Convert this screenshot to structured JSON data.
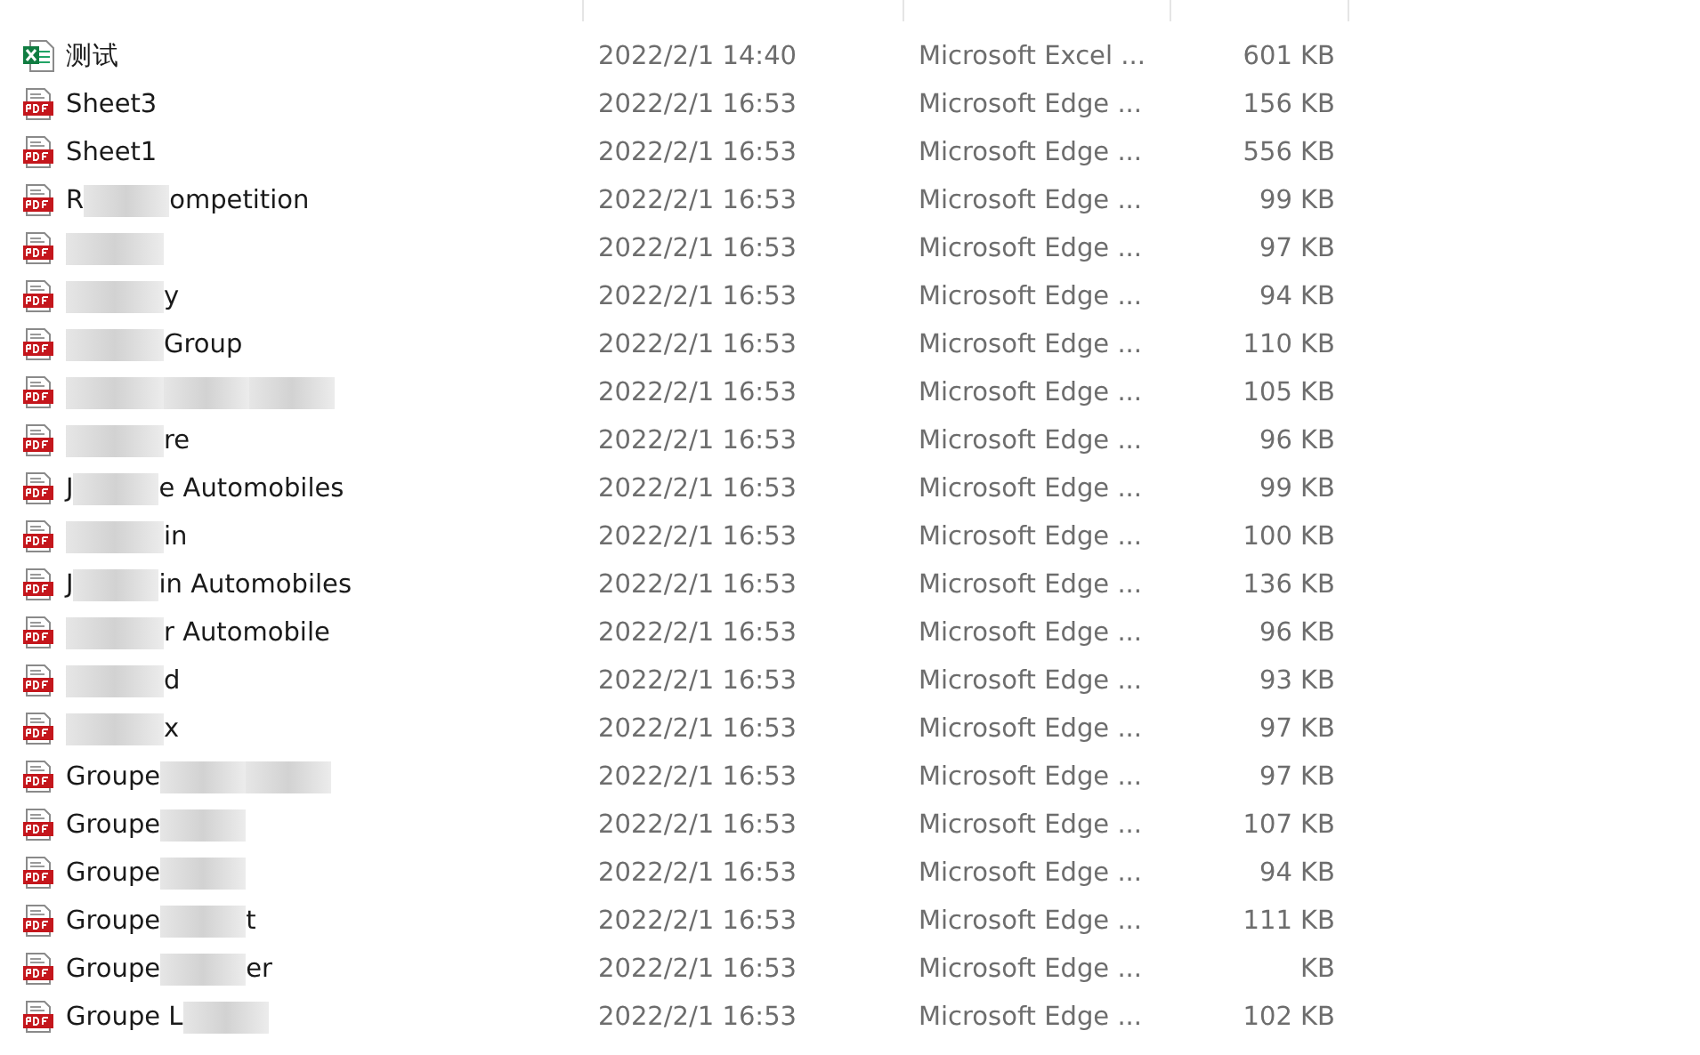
{
  "files": [
    {
      "kind": "excel",
      "name": [
        {
          "kind": "text",
          "text": "测试"
        }
      ],
      "modified": "2022/2/1 14:40",
      "type": "Microsoft Excel ...",
      "size": "601 KB"
    },
    {
      "kind": "pdf",
      "name": [
        {
          "kind": "text",
          "text": "Sheet3"
        }
      ],
      "modified": "2022/2/1 16:53",
      "type": "Microsoft Edge ...",
      "size": "156 KB"
    },
    {
      "kind": "pdf",
      "name": [
        {
          "kind": "text",
          "text": "Sheet1"
        }
      ],
      "modified": "2022/2/1 16:53",
      "type": "Microsoft Edge ...",
      "size": "556 KB"
    },
    {
      "kind": "pdf",
      "name": [
        {
          "kind": "text",
          "text": "R"
        },
        {
          "kind": "blur"
        },
        {
          "kind": "text",
          "text": "ompetition"
        }
      ],
      "modified": "2022/2/1 16:53",
      "type": "Microsoft Edge ...",
      "size": "99 KB"
    },
    {
      "kind": "pdf",
      "name": [
        {
          "kind": "blur"
        }
      ],
      "modified": "2022/2/1 16:53",
      "type": "Microsoft Edge ...",
      "size": "97 KB"
    },
    {
      "kind": "pdf",
      "name": [
        {
          "kind": "blur"
        },
        {
          "kind": "text",
          "text": "y"
        }
      ],
      "modified": "2022/2/1 16:53",
      "type": "Microsoft Edge ...",
      "size": "94 KB"
    },
    {
      "kind": "pdf",
      "name": [
        {
          "kind": "blur"
        },
        {
          "kind": "text",
          "text": "Group"
        }
      ],
      "modified": "2022/2/1 16:53",
      "type": "Microsoft Edge ...",
      "size": "110 KB"
    },
    {
      "kind": "pdf",
      "name": [
        {
          "kind": "blur"
        },
        {
          "kind": "blur"
        },
        {
          "kind": "blur"
        }
      ],
      "modified": "2022/2/1 16:53",
      "type": "Microsoft Edge ...",
      "size": "105 KB"
    },
    {
      "kind": "pdf",
      "name": [
        {
          "kind": "blur"
        },
        {
          "kind": "text",
          "text": "re"
        }
      ],
      "modified": "2022/2/1 16:53",
      "type": "Microsoft Edge ...",
      "size": "96 KB"
    },
    {
      "kind": "pdf",
      "name": [
        {
          "kind": "text",
          "text": "J"
        },
        {
          "kind": "blur"
        },
        {
          "kind": "text",
          "text": "e Automobiles"
        }
      ],
      "modified": "2022/2/1 16:53",
      "type": "Microsoft Edge ...",
      "size": "99 KB"
    },
    {
      "kind": "pdf",
      "name": [
        {
          "kind": "blur"
        },
        {
          "kind": "text",
          "text": "in"
        }
      ],
      "modified": "2022/2/1 16:53",
      "type": "Microsoft Edge ...",
      "size": "100 KB"
    },
    {
      "kind": "pdf",
      "name": [
        {
          "kind": "text",
          "text": "J"
        },
        {
          "kind": "blur"
        },
        {
          "kind": "text",
          "text": "in Automobiles"
        }
      ],
      "modified": "2022/2/1 16:53",
      "type": "Microsoft Edge ...",
      "size": "136 KB"
    },
    {
      "kind": "pdf",
      "name": [
        {
          "kind": "blur"
        },
        {
          "kind": "text",
          "text": "r Automobile"
        }
      ],
      "modified": "2022/2/1 16:53",
      "type": "Microsoft Edge ...",
      "size": "96 KB"
    },
    {
      "kind": "pdf",
      "name": [
        {
          "kind": "blur"
        },
        {
          "kind": "text",
          "text": "d"
        }
      ],
      "modified": "2022/2/1 16:53",
      "type": "Microsoft Edge ...",
      "size": "93 KB"
    },
    {
      "kind": "pdf",
      "name": [
        {
          "kind": "blur"
        },
        {
          "kind": "text",
          "text": "x"
        }
      ],
      "modified": "2022/2/1 16:53",
      "type": "Microsoft Edge ...",
      "size": "97 KB"
    },
    {
      "kind": "pdf",
      "name": [
        {
          "kind": "text",
          "text": "Groupe"
        },
        {
          "kind": "blur"
        },
        {
          "kind": "blur"
        }
      ],
      "modified": "2022/2/1 16:53",
      "type": "Microsoft Edge ...",
      "size": "97 KB"
    },
    {
      "kind": "pdf",
      "name": [
        {
          "kind": "text",
          "text": "Groupe"
        },
        {
          "kind": "blur"
        }
      ],
      "modified": "2022/2/1 16:53",
      "type": "Microsoft Edge ...",
      "size": "107 KB"
    },
    {
      "kind": "pdf",
      "name": [
        {
          "kind": "text",
          "text": "Groupe"
        },
        {
          "kind": "blur"
        }
      ],
      "modified": "2022/2/1 16:53",
      "type": "Microsoft Edge ...",
      "size": "94 KB"
    },
    {
      "kind": "pdf",
      "name": [
        {
          "kind": "text",
          "text": "Groupe"
        },
        {
          "kind": "blur"
        },
        {
          "kind": "text",
          "text": "t"
        }
      ],
      "modified": "2022/2/1 16:53",
      "type": "Microsoft Edge ...",
      "size": "111 KB"
    },
    {
      "kind": "pdf",
      "name": [
        {
          "kind": "text",
          "text": "Groupe"
        },
        {
          "kind": "blur"
        },
        {
          "kind": "text",
          "text": "er"
        }
      ],
      "modified": "2022/2/1 16:53",
      "type": "Microsoft Edge ...",
      "size": "KB"
    },
    {
      "kind": "pdf",
      "name": [
        {
          "kind": "text",
          "text": "Groupe L"
        },
        {
          "kind": "blur"
        }
      ],
      "modified": "2022/2/1 16:53",
      "type": "Microsoft Edge ...",
      "size": "102 KB"
    }
  ]
}
